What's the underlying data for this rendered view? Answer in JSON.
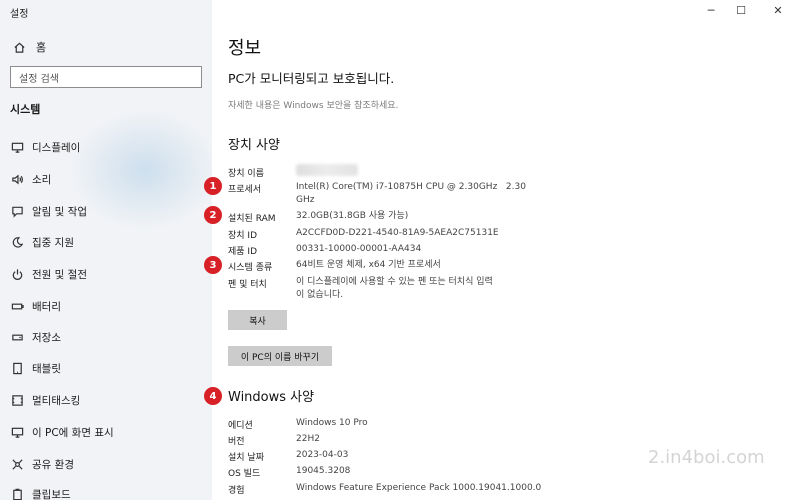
{
  "window": {
    "title": "설정",
    "minimize": "─",
    "maximize": "☐",
    "close": "✕"
  },
  "sidebar": {
    "home": "홈",
    "search_placeholder": "설정 검색",
    "section": "시스템",
    "items": [
      {
        "label": "디스플레이",
        "icon": "monitor-icon"
      },
      {
        "label": "소리",
        "icon": "speaker-icon"
      },
      {
        "label": "알림 및 작업",
        "icon": "notification-icon"
      },
      {
        "label": "집중 지원",
        "icon": "moon-icon"
      },
      {
        "label": "전원 및 절전",
        "icon": "power-icon"
      },
      {
        "label": "배터리",
        "icon": "battery-icon"
      },
      {
        "label": "저장소",
        "icon": "storage-icon"
      },
      {
        "label": "태블릿",
        "icon": "tablet-icon"
      },
      {
        "label": "멀티태스킹",
        "icon": "multitasking-icon"
      },
      {
        "label": "이 PC에 화면 표시",
        "icon": "project-icon"
      },
      {
        "label": "공유 환경",
        "icon": "share-icon"
      },
      {
        "label": "클립보드",
        "icon": "clipboard-icon"
      }
    ]
  },
  "main": {
    "title": "정보",
    "protect": "PC가 모니터링되고 보호됩니다.",
    "security_link": "자세한 내용은 Windows 보안을 참조하세요.",
    "device_heading": "장치 사양",
    "device": {
      "name_label": "장치 이름",
      "processor_label": "프로세서",
      "processor_value": "Intel(R) Core(TM) i7-10875H CPU @ 2.30GHz   2.30",
      "processor_value2": "GHz",
      "ram_label": "설치된 RAM",
      "ram_value": "32.0GB(31.8GB 사용 가능)",
      "device_id_label": "장치 ID",
      "device_id_value": "A2CCFD0D-D221-4540-81A9-5AEA2C75131E",
      "product_id_label": "제품 ID",
      "product_id_value": "00331-10000-00001-AA434",
      "system_type_label": "시스템 종류",
      "system_type_value": "64비트 운영 체제, x64 기반 프로세서",
      "pen_label": "펜 및 터치",
      "pen_value": "이 디스플레이에 사용할 수 있는 펜 또는 터치식 입력",
      "pen_value2": "이 없습니다."
    },
    "copy_button": "복사",
    "rename_button": "이 PC의 이름 바꾸기",
    "windows_heading": "Windows 사양",
    "windows": {
      "edition_label": "에디션",
      "edition_value": "Windows 10 Pro",
      "version_label": "버전",
      "version_value": "22H2",
      "install_label": "설치 날짜",
      "install_value": "2023-04-03",
      "build_label": "OS 빌드",
      "build_value": "19045.3208",
      "experience_label": "경험",
      "experience_value": "Windows Feature Experience Pack 1000.19041.1000.0"
    }
  },
  "markers": [
    "1",
    "2",
    "3",
    "4"
  ],
  "watermark": "2.in4boi.com",
  "colors": {
    "marker": "#d82127",
    "sidebar_bg": "#f1f3f6",
    "button_bg": "#cccccc"
  }
}
